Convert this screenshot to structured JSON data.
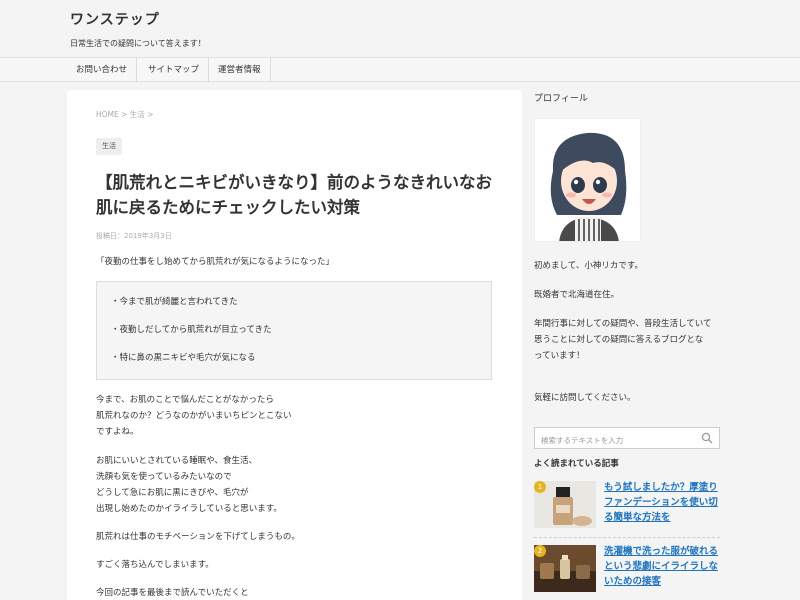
{
  "site": {
    "title": "ワンステップ",
    "description": "日常生活での疑問について答えます！"
  },
  "nav": {
    "items": [
      "お問い合わせ",
      "サイトマップ",
      "運営者情報"
    ]
  },
  "article": {
    "breadcrumb": "HOME > 生活 >",
    "category": "生活",
    "title": "【肌荒れとニキビがいきなり】前のようなきれいなお肌に戻るためにチェックしたい対策",
    "date": "投稿日：2019年3月3日",
    "quote": "「夜勤の仕事をし始めてから肌荒れが気になるようになった」",
    "box_items": [
      "・今まで肌が綺麗と言われてきた",
      "・夜勤しだしてから肌荒れが目立ってきた",
      "・特に鼻の黒ニキビや毛穴が気になる"
    ],
    "paragraphs": [
      "今まで、お肌のことで悩んだことがなかったら\n肌荒れなのか？どうなのかがいまいちピンとこない\nですよね。",
      "お肌にいいとされている睡眠や、食生活、\n洗顔も気を使っているみたいなので\nどうして急にお肌に黒にきびや、毛穴が\n出現し始めたのかイライラしていると思います。",
      "肌荒れは仕事のモチベーションを下げてしまうもの。",
      "すごく落ち込んでしまいます。",
      "今回の記事を最後まで読んでいただくと"
    ]
  },
  "sidebar": {
    "profile_heading": "プロフィール",
    "profile_texts": [
      "初めまして、小神リカです。",
      "既婚者で北海道在住。",
      "年間行事に対しての疑問や、普段生活していて\n思うことに対しての疑問に答えるブログとな\nっています！",
      "気軽に訪問してください。"
    ],
    "search": {
      "placeholder": "検索するテキストを入力",
      "icon": "search-icon"
    },
    "popular_heading": "よく読まれている記事",
    "popular": [
      {
        "rank": "1",
        "title": "もう試しましたか？厚塗りファンデーションを使い切る簡単な方法を"
      },
      {
        "rank": "2",
        "title": "洗濯機で洗った服が破れるという悲劇にイライラしないための接客"
      }
    ]
  },
  "colors": {
    "background": "#f4f4f4",
    "card": "#ffffff",
    "link": "#1e73be",
    "rank_badge": "#e6b422"
  }
}
